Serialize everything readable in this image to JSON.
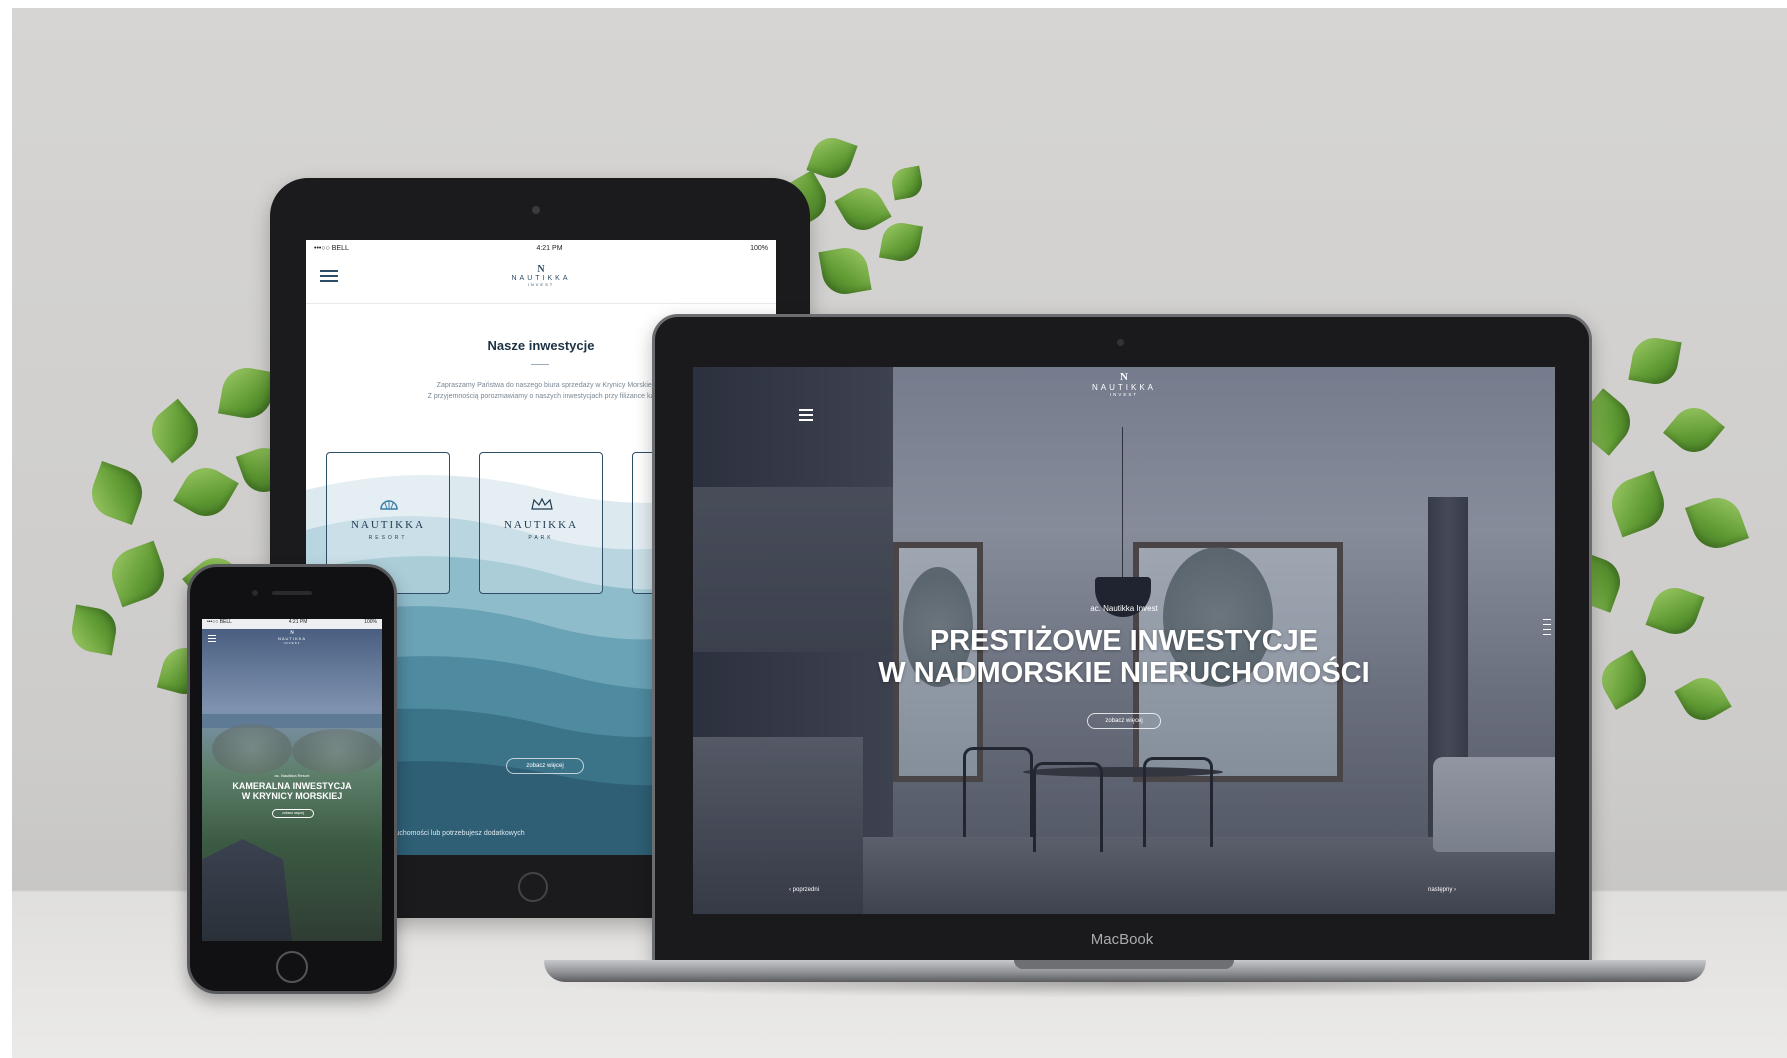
{
  "tablet": {
    "status": {
      "carrier": "•••○○ BELL",
      "time": "4:21 PM",
      "battery": "100%"
    },
    "logo": {
      "mark": "N",
      "name": "NAUTIKKA",
      "sub": "INVEST"
    },
    "section_title": "Nasze inwestycje",
    "intro_line1": "Zapraszamy Państwa do naszego biura sprzedaży w Krynicy Morskiej.",
    "intro_line2": "Z przyjemnością porozmawiamy o naszych inwestycjach przy filiżance kawy.",
    "cards": [
      {
        "name": "NAUTIKKA",
        "sub": "RESORT"
      },
      {
        "name": "NAUTIKKA",
        "sub": "PARK"
      }
    ],
    "button": "zobacz więcej",
    "bottom_text": "...nteresowany zakupem nieruchomości lub potrzebujesz dodatkowych"
  },
  "laptop": {
    "logo": {
      "mark": "N",
      "name": "NAUTIKKA",
      "sub": "INVEST"
    },
    "kicker": "ac. Nautikka Invest",
    "headline_line1": "PRESTIŻOWE INWESTYCJE",
    "headline_line2": "W NADMORSKIE NIERUCHOMOŚCI",
    "button": "zobacz więcej",
    "prev": "poprzedni",
    "next": "następny",
    "brand_label": "MacBook"
  },
  "phone": {
    "status": {
      "carrier": "•••○○ BELL",
      "time": "4:21 PM",
      "battery": "100%"
    },
    "logo": {
      "mark": "N",
      "name": "NAUTIKKA",
      "sub": "INVEST"
    },
    "kicker": "ac. Nautikka Resort",
    "headline_line1": "KAMERALNA INWESTYCJA",
    "headline_line2": "W KRYNICY MORSKIEJ",
    "button": "zobacz więcej"
  },
  "colors": {
    "brand_navy": "#2b4a63",
    "wave_teal": "#3f7f93",
    "leaf_green": "#6aa23a"
  }
}
